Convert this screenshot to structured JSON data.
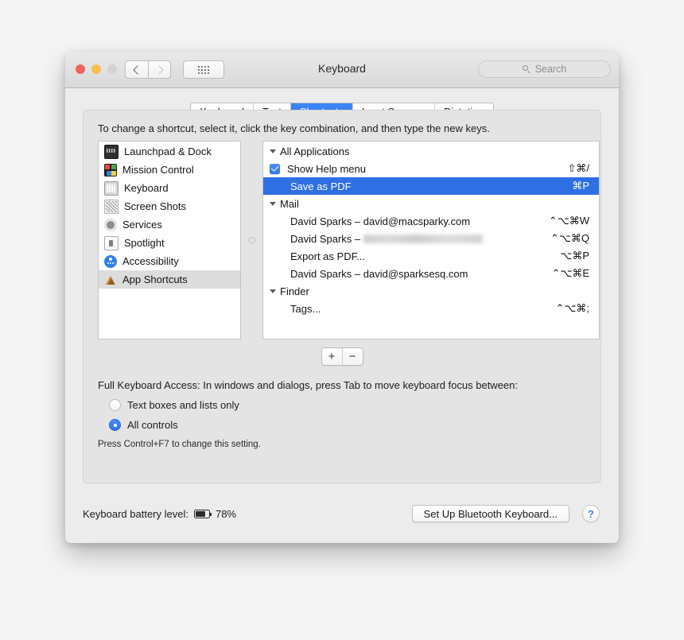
{
  "window": {
    "title": "Keyboard",
    "traffic_lights": [
      "close",
      "minimize",
      "zoom-disabled"
    ],
    "nav": {
      "back": "back-chevron",
      "forward": "forward-chevron-disabled"
    },
    "grid_button": "show-all-preferences-grid",
    "search": {
      "placeholder": "Search",
      "value": "",
      "icon": "search-icon"
    }
  },
  "tabs": [
    {
      "label": "Keyboard",
      "active": false
    },
    {
      "label": "Text",
      "active": false
    },
    {
      "label": "Shortcuts",
      "active": true
    },
    {
      "label": "Input Sources",
      "active": false
    },
    {
      "label": "Dictation",
      "active": false
    }
  ],
  "hint": "To change a shortcut, select it, click the key combination, and then type the new keys.",
  "sidebar": {
    "items": [
      {
        "label": "Launchpad & Dock",
        "icon": "launchpad-dock-icon",
        "selected": false
      },
      {
        "label": "Mission Control",
        "icon": "mission-control-icon",
        "selected": false
      },
      {
        "label": "Keyboard",
        "icon": "keyboard-icon",
        "selected": false
      },
      {
        "label": "Screen Shots",
        "icon": "screenshot-icon",
        "selected": false
      },
      {
        "label": "Services",
        "icon": "services-gear-icon",
        "selected": false
      },
      {
        "label": "Spotlight",
        "icon": "spotlight-icon",
        "selected": false
      },
      {
        "label": "Accessibility",
        "icon": "accessibility-icon",
        "selected": false
      },
      {
        "label": "App Shortcuts",
        "icon": "app-shortcuts-icon",
        "selected": true
      }
    ]
  },
  "shortcuts": {
    "groups": [
      {
        "name": "All Applications",
        "expanded": true,
        "rows": [
          {
            "label": "Show Help menu",
            "combo": "⇧⌘/",
            "checkbox": true,
            "checked": true,
            "selected": false,
            "redacted": false
          },
          {
            "label": "Save as PDF",
            "combo": "⌘P",
            "checkbox": false,
            "checked": false,
            "selected": true,
            "redacted": false
          }
        ]
      },
      {
        "name": "Mail",
        "expanded": true,
        "rows": [
          {
            "label": "David Sparks – david@macsparky.com",
            "combo": "⌃⌥⌘W",
            "checkbox": false,
            "checked": false,
            "selected": false,
            "redacted": false
          },
          {
            "label": "David Sparks – ",
            "combo": "⌃⌥⌘Q",
            "checkbox": false,
            "checked": false,
            "selected": false,
            "redacted": true
          },
          {
            "label": "Export as PDF...",
            "combo": "⌥⌘P",
            "checkbox": false,
            "checked": false,
            "selected": false,
            "redacted": false
          },
          {
            "label": "David Sparks – david@sparksesq.com",
            "combo": "⌃⌥⌘E",
            "checkbox": false,
            "checked": false,
            "selected": false,
            "redacted": false
          }
        ]
      },
      {
        "name": "Finder",
        "expanded": true,
        "rows": [
          {
            "label": "Tags...",
            "combo": "⌃⌥⌘;",
            "checkbox": false,
            "checked": false,
            "selected": false,
            "redacted": false
          }
        ]
      }
    ],
    "add_label": "+",
    "remove_label": "−"
  },
  "full_keyboard_access": {
    "label": "Full Keyboard Access: In windows and dialogs, press Tab to move keyboard focus between:",
    "options": [
      {
        "label": "Text boxes and lists only",
        "selected": false
      },
      {
        "label": "All controls",
        "selected": true
      }
    ],
    "note": "Press Control+F7 to change this setting."
  },
  "bottom": {
    "battery_label": "Keyboard battery level:",
    "battery_icon": "battery-icon",
    "battery_value": "78%",
    "bluetooth_button": "Set Up Bluetooth Keyboard...",
    "help_button": "?"
  },
  "colors": {
    "accent": "#2f6fe4",
    "tab_active": "#3d86f5",
    "selection": "#2f6fe4"
  }
}
